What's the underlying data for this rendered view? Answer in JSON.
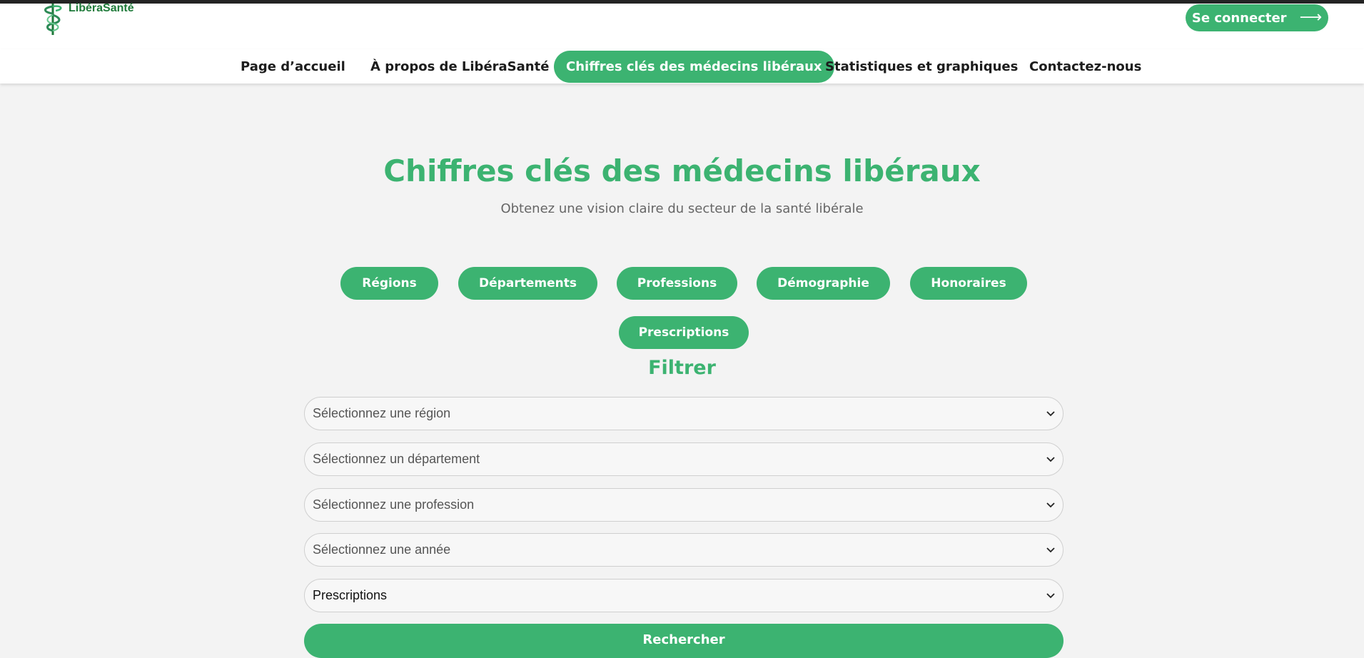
{
  "brand": {
    "name": "LibéraSanté",
    "accent_color": "#3cb371",
    "logo_icon": "caduceus-icon"
  },
  "header": {
    "login_label": "Se connecter",
    "login_icon": "arrow-right-icon",
    "login_arrow": "⟶"
  },
  "nav": {
    "items": [
      {
        "label": "Page d’accueil"
      },
      {
        "label": "À propos de LibéraSanté"
      },
      {
        "label": "Chiffres clés des médecins libéraux",
        "active": true
      },
      {
        "label": "Statistiques et graphiques"
      },
      {
        "label": "Contactez-nous"
      }
    ]
  },
  "hero": {
    "title": "Chiffres clés des médecins libéraux",
    "subtitle": "Obtenez une vision claire du secteur de la santé libérale"
  },
  "categories": [
    {
      "label": "Régions"
    },
    {
      "label": "Départements"
    },
    {
      "label": "Professions"
    },
    {
      "label": "Démographie"
    },
    {
      "label": "Honoraires"
    },
    {
      "label": "Prescriptions"
    }
  ],
  "filter": {
    "title": "Filtrer",
    "selects": [
      {
        "value": "Sélectionnez une région",
        "is_placeholder": true
      },
      {
        "value": "Sélectionnez un département",
        "is_placeholder": true
      },
      {
        "value": "Sélectionnez une profession",
        "is_placeholder": true
      },
      {
        "value": "Sélectionnez une année",
        "is_placeholder": true
      },
      {
        "value": "Prescriptions",
        "is_placeholder": false
      }
    ],
    "select_icon": "chevron-down-icon",
    "submit_label": "Rechercher"
  }
}
